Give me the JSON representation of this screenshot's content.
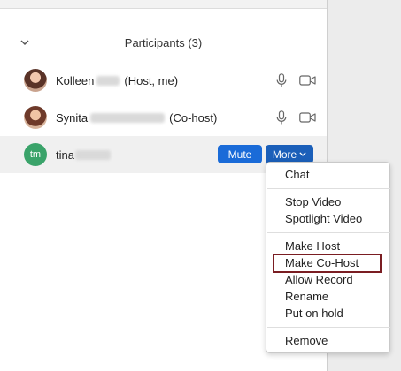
{
  "panel": {
    "title": "Participants (3)"
  },
  "participants": [
    {
      "first": "Kolleen",
      "suffix": "(Host, me)",
      "avatar": "photo"
    },
    {
      "first": "Synita",
      "suffix": "(Co-host)",
      "avatar": "photo"
    },
    {
      "first": "tina",
      "suffix": "",
      "avatar": "initials",
      "initials": "tm"
    }
  ],
  "actions": {
    "mute_label": "Mute",
    "more_label": "More"
  },
  "menu": {
    "items": [
      "Chat",
      "Stop Video",
      "Spotlight Video",
      "Make Host",
      "Make Co-Host",
      "Allow Record",
      "Rename",
      "Put on hold",
      "Remove"
    ],
    "highlighted": "Make Co-Host"
  },
  "colors": {
    "button_blue": "#1a6bd8",
    "avatar_green": "#3aa36a",
    "highlight_border": "#7a1d22"
  },
  "icons": [
    "chevron-down-icon",
    "microphone-icon",
    "video-camera-icon"
  ]
}
